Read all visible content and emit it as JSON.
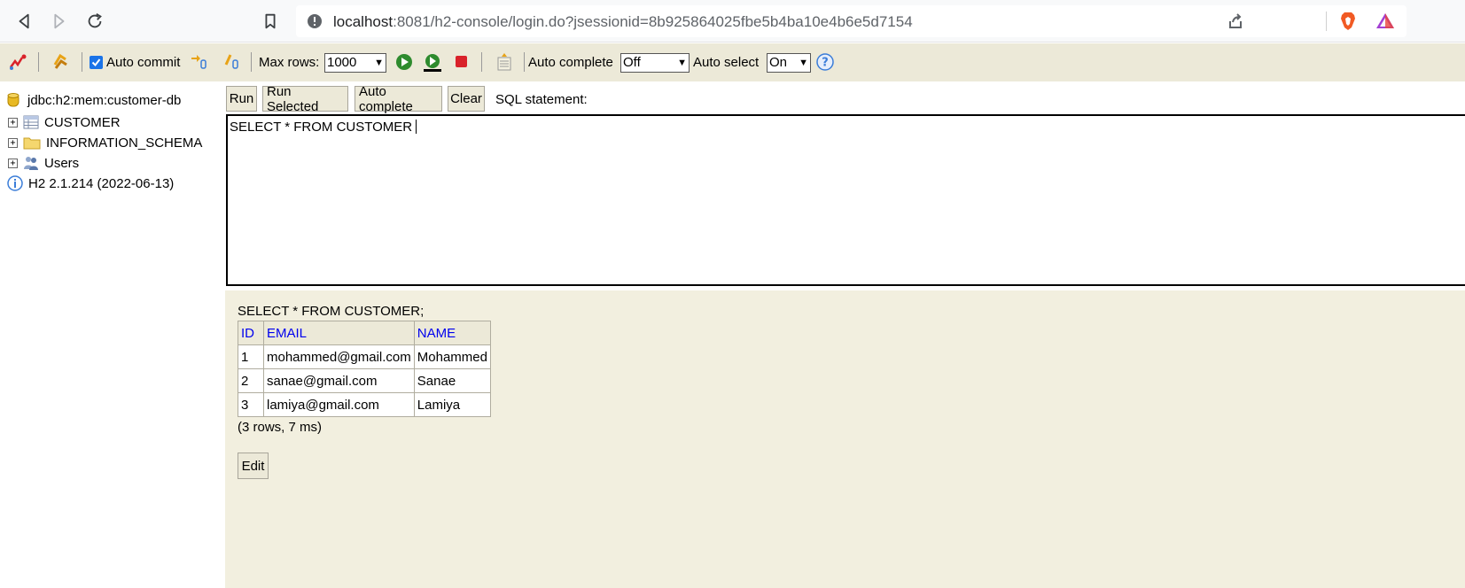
{
  "browser": {
    "url_host": "localhost",
    "url_rest": ":8081/h2-console/login.do?jsessionid=8b925864025fbe5b4ba10e4b6e5d7154",
    "icons": [
      "back-icon",
      "forward-icon",
      "reload-icon",
      "bookmark-icon",
      "site-info-icon",
      "share-icon",
      "brave-shield-icon",
      "brave-rewards-icon"
    ]
  },
  "toolbar": {
    "auto_commit_label": "Auto commit",
    "auto_commit_checked": true,
    "max_rows_label": "Max rows:",
    "max_rows_value": "1000",
    "auto_complete_label": "Auto complete",
    "auto_complete_value": "Off",
    "auto_select_label": "Auto select",
    "auto_select_value": "On",
    "colors": {
      "background": "#ece9d8",
      "run_green": "#2e8b2e",
      "stop_red": "#d9222a",
      "help_blue": "#3b7dd8"
    }
  },
  "tree": {
    "connection": "jdbc:h2:mem:customer-db",
    "nodes": [
      {
        "label": "CUSTOMER",
        "icon": "table-icon"
      },
      {
        "label": "INFORMATION_SCHEMA",
        "icon": "folder-icon"
      },
      {
        "label": "Users",
        "icon": "users-icon"
      }
    ],
    "version": "H2 2.1.214 (2022-06-13)"
  },
  "query": {
    "run_label": "Run",
    "run_selected_label": "Run Selected",
    "auto_complete_label": "Auto complete",
    "clear_label": "Clear",
    "sql_statement_label": "SQL statement:",
    "editor_text": "SELECT * FROM CUSTOMER"
  },
  "result": {
    "sql": "SELECT * FROM CUSTOMER;",
    "columns": [
      "ID",
      "EMAIL",
      "NAME"
    ],
    "rows": [
      [
        "1",
        "mohammed@gmail.com",
        "Mohammed"
      ],
      [
        "2",
        "sanae@gmail.com",
        "Sanae"
      ],
      [
        "3",
        "lamiya@gmail.com",
        "Lamiya"
      ]
    ],
    "summary": "(3 rows, 7 ms)",
    "edit_label": "Edit"
  }
}
